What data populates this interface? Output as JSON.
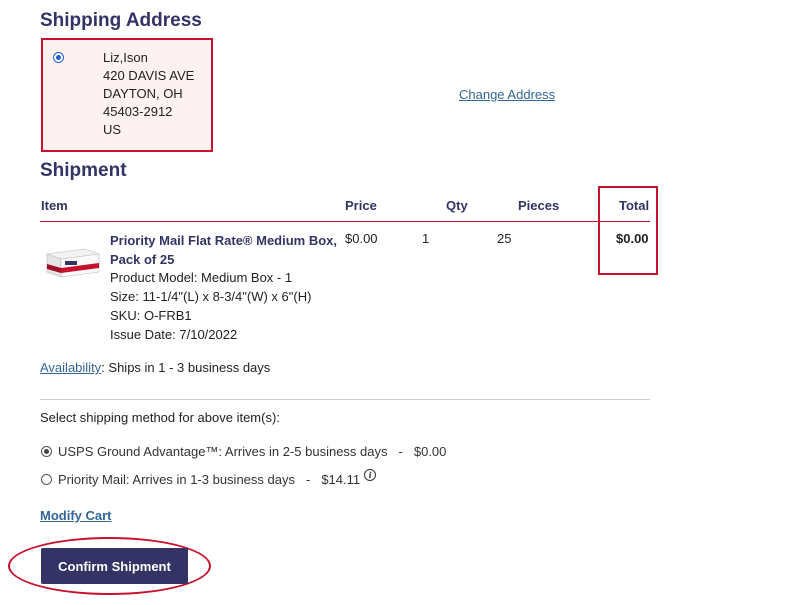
{
  "shipping_address": {
    "heading": "Shipping Address",
    "lines": [
      "Liz,Ison",
      "420 DAVIS AVE",
      "DAYTON, OH",
      "45403-2912",
      "US"
    ],
    "change_link": "Change Address"
  },
  "shipment": {
    "heading": "Shipment",
    "columns": {
      "item": "Item",
      "price": "Price",
      "qty": "Qty",
      "pieces": "Pieces",
      "total": "Total"
    },
    "item": {
      "name": "Priority Mail Flat Rate® Medium Box, Pack of 25",
      "model": "Product Model: Medium Box - 1",
      "size": "Size: 11-1/4\"(L) x 8-3/4\"(W) x 6\"(H)",
      "sku": "SKU: O-FRB1",
      "issue_date": "Issue Date: 7/10/2022",
      "price": "$0.00",
      "qty": "1",
      "pieces": "25",
      "total": "$0.00",
      "image_icon": "shipping-box-icon"
    },
    "availability_link": "Availability",
    "availability_text": ": Ships in 1 - 3 business days"
  },
  "shipping_method": {
    "prompt": "Select shipping method for above item(s):",
    "options": [
      {
        "label": "USPS Ground Advantage™: Arrives in 2-5 business days",
        "sep": "-",
        "price": "$0.00",
        "selected": true
      },
      {
        "label": "Priority Mail: Arrives in 1-3 business days",
        "sep": "-",
        "price": "$14.11",
        "selected": false
      }
    ],
    "info_icon": "i"
  },
  "actions": {
    "modify_cart": "Modify Cart",
    "confirm": "Confirm Shipment"
  },
  "colors": {
    "accent": "#333366",
    "highlight_border": "#c8102e",
    "link": "#336699"
  }
}
